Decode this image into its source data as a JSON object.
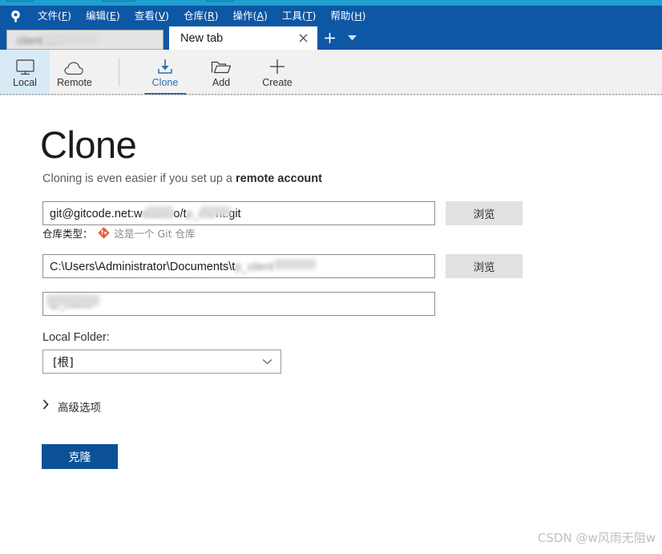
{
  "colors": {
    "titlebar_blue": "#0e57a5",
    "accent_blue": "#2a6fb5",
    "primary_button": "#0c5198",
    "selected_tab_bg": "#d9eaf7",
    "git_orange": "#e8613a",
    "toolbar_bg": "#f1f1f1",
    "watermark_gray": "#bfbfbf"
  },
  "menubar": {
    "logo_icon": "sourcetree-logo-icon",
    "items": [
      {
        "label": "文件(F)",
        "text": "文件",
        "accel": "F"
      },
      {
        "label": "编辑(E)",
        "text": "编辑",
        "accel": "E"
      },
      {
        "label": "查看(V)",
        "text": "查看",
        "accel": "V"
      },
      {
        "label": "仓库(R)",
        "text": "仓库",
        "accel": "R"
      },
      {
        "label": "操作(A)",
        "text": "操作",
        "accel": "A"
      },
      {
        "label": "工具(T)",
        "text": "工具",
        "accel": "T"
      },
      {
        "label": "帮助(H)",
        "text": "帮助",
        "accel": "H"
      }
    ]
  },
  "tabs": {
    "items": [
      {
        "label": "",
        "redacted": true,
        "active": false
      },
      {
        "label": "New tab",
        "redacted": false,
        "active": true
      }
    ],
    "close_icon": "close-icon",
    "new_tab_icon": "plus-icon",
    "tab_menu_icon": "chevron-down-icon"
  },
  "toolbar": {
    "buttons": [
      {
        "label": "Local",
        "icon": "monitor-icon",
        "selected": true,
        "accent": false
      },
      {
        "label": "Remote",
        "icon": "cloud-icon",
        "selected": false,
        "accent": false
      },
      {
        "label": "Clone",
        "icon": "download-icon",
        "selected": false,
        "accent": true
      },
      {
        "label": "Add",
        "icon": "folder-icon",
        "selected": false,
        "accent": false
      },
      {
        "label": "Create",
        "icon": "plus-icon",
        "selected": false,
        "accent": false
      }
    ]
  },
  "clone_page": {
    "title": "Clone",
    "subtitle_prefix": "Cloning is even easier if you set up a ",
    "subtitle_link": "remote account",
    "source_url": {
      "value": "git@gitcode.net:w      o/t   nt.git",
      "value_visible_prefix": "git@gitcode.net:w",
      "value_visible_middle": "o/t",
      "value_visible_suffix": "nt.git",
      "placeholder": "",
      "browse_label": "浏览"
    },
    "repo_type": {
      "label": "仓库类型：",
      "icon": "git-diamond-icon",
      "text": "这是一个 Git 仓库"
    },
    "destination_path": {
      "value": "C:\\Users\\Administrator\\Documents\\t",
      "value_full": "C:\\Users\\Administrator\\Documents\\t      nt",
      "placeholder": "",
      "browse_label": "浏览"
    },
    "name_field": {
      "value": "",
      "redacted": true,
      "placeholder": ""
    },
    "local_folder": {
      "label": "Local Folder:",
      "selected_value": "[根]",
      "chevron_icon": "chevron-down-icon"
    },
    "advanced_options": {
      "label": "高级选项",
      "chevron_icon": "chevron-right-icon",
      "expanded": false
    },
    "clone_button": {
      "label": "克隆"
    }
  },
  "watermark": {
    "text": "CSDN @w风雨无阻w"
  }
}
